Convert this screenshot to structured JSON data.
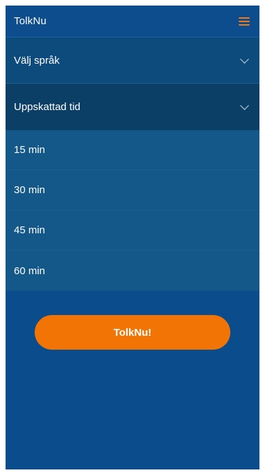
{
  "header": {
    "title": "TolkNu",
    "menu_icon": "hamburger-menu-icon",
    "menu_color": "#f27b17"
  },
  "language_select": {
    "label": "Välj språk"
  },
  "time_select": {
    "label": "Uppskattad tid",
    "options": [
      "15 min",
      "30 min",
      "45 min",
      "60 min"
    ]
  },
  "cta": {
    "label": "TolkNu!",
    "color": "#f27405"
  },
  "colors": {
    "background": "#0b4c8c",
    "accent": "#f27405"
  }
}
